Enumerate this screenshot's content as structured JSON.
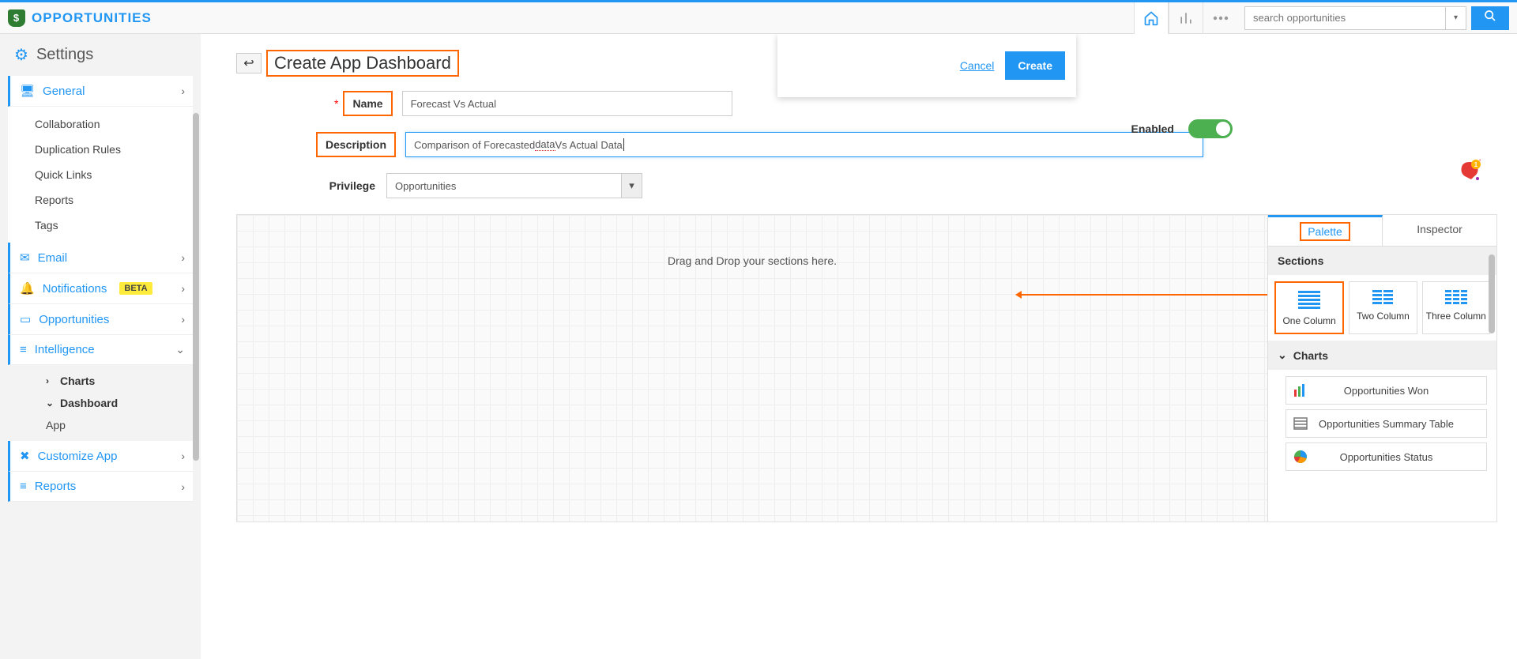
{
  "brand": "OPPORTUNITIES",
  "topbar": {
    "search_placeholder": "search opportunities"
  },
  "sidebar": {
    "title": "Settings",
    "items": [
      {
        "label": "General",
        "icon": "monitor-icon",
        "children": [
          "Collaboration",
          "Duplication Rules",
          "Quick Links",
          "Reports",
          "Tags"
        ]
      },
      {
        "label": "Email",
        "icon": "mail-icon"
      },
      {
        "label": "Notifications",
        "icon": "bell-icon",
        "badge": "BETA"
      },
      {
        "label": "Opportunities",
        "icon": "window-icon"
      },
      {
        "label": "Intelligence",
        "icon": "lines-icon",
        "open": true,
        "children2": [
          {
            "label": "Charts",
            "expand": false
          },
          {
            "label": "Dashboard",
            "expand": true,
            "children": [
              "App"
            ]
          }
        ]
      },
      {
        "label": "Customize App",
        "icon": "tools-icon"
      },
      {
        "label": "Reports",
        "icon": "lines-icon"
      }
    ]
  },
  "page": {
    "title": "Create App Dashboard",
    "actions": {
      "cancel": "Cancel",
      "create": "Create"
    },
    "form": {
      "name_label": "Name",
      "name_value": "Forecast Vs Actual",
      "desc_label": "Description",
      "desc_value_pre": "Comparison of Forecasted ",
      "desc_value_underlined": "data",
      "desc_value_post": " Vs Actual Data",
      "priv_label": "Privilege",
      "priv_value": "Opportunities",
      "enabled_label": "Enabled"
    },
    "canvas_hint": "Drag and Drop your sections here."
  },
  "palette": {
    "tabs": [
      "Palette",
      "Inspector"
    ],
    "sections_header": "Sections",
    "sections": [
      "One Column",
      "Two Column",
      "Three Column"
    ],
    "charts_header": "Charts",
    "charts": [
      "Opportunities Won",
      "Opportunities Summary Table",
      "Opportunities Status"
    ]
  }
}
